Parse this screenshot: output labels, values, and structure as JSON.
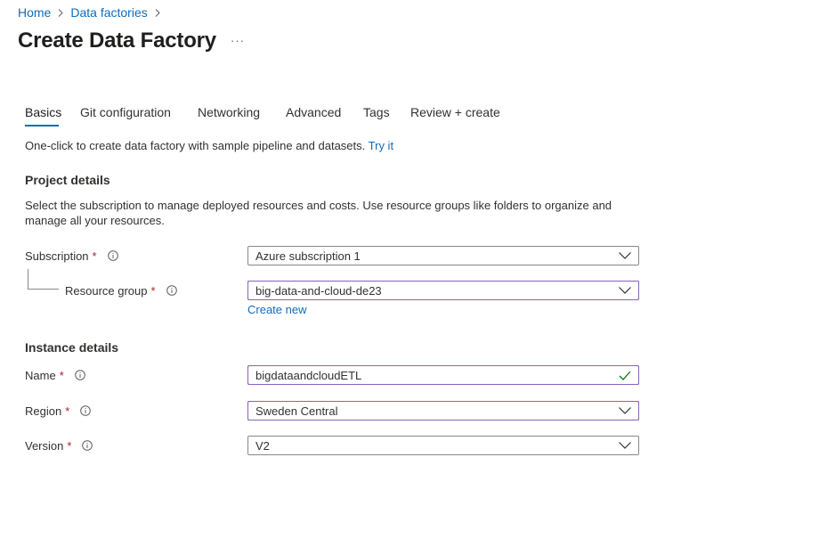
{
  "breadcrumb": {
    "items": [
      "Home",
      "Data factories"
    ]
  },
  "page": {
    "title": "Create Data Factory",
    "more": "···"
  },
  "tabs": [
    "Basics",
    "Git configuration",
    "Networking",
    "Advanced",
    "Tags",
    "Review + create"
  ],
  "oneclick": {
    "text": "One-click to create data factory with sample pipeline and datasets.",
    "link": "Try it"
  },
  "project": {
    "heading": "Project details",
    "description": "Select the subscription to manage deployed resources and costs. Use resource groups like folders to organize and manage all your resources."
  },
  "fields": {
    "subscription": {
      "label": "Subscription",
      "value": "Azure subscription 1"
    },
    "resource_group": {
      "label": "Resource group",
      "value": "big-data-and-cloud-de23",
      "create_new": "Create new"
    },
    "name": {
      "label": "Name",
      "value": "bigdataandcloudETL"
    },
    "region": {
      "label": "Region",
      "value": "Sweden Central"
    },
    "version": {
      "label": "Version",
      "value": "V2"
    }
  },
  "instance": {
    "heading": "Instance details"
  },
  "required_marker": "*",
  "icons": {
    "info": "info-icon",
    "dropdown": "chevron-down-icon",
    "valid": "checkmark-icon",
    "separator": "chevron-right-icon"
  },
  "colors": {
    "link": "#0f6cbd",
    "required": "#a4262c",
    "focus_border": "#8764b8",
    "valid": "#107c10"
  }
}
